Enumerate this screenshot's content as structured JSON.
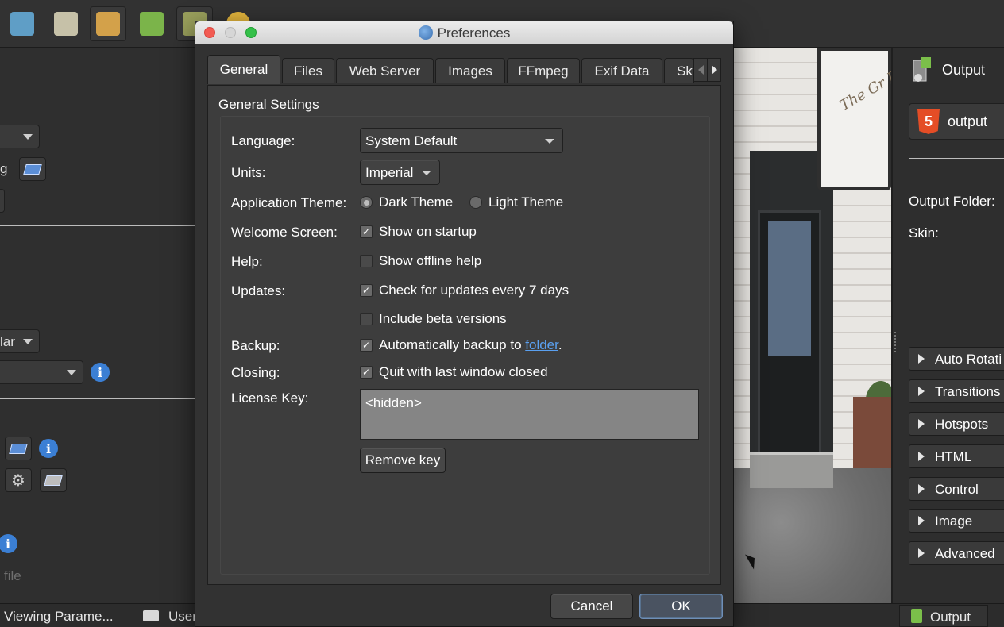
{
  "toolbar": {
    "buttons": [
      {
        "name": "screen-view-icon",
        "color": "#5f9ec6"
      },
      {
        "name": "contact-card-icon",
        "color": "#c6c1a8"
      },
      {
        "name": "flow-diagram-icon",
        "color": "#d3a14a"
      },
      {
        "name": "map-pin-icon",
        "color": "#7bb44a"
      },
      {
        "name": "tool-icon",
        "color": "#9aa05c"
      },
      {
        "name": "google-icon",
        "color": "#e2b43c"
      }
    ]
  },
  "left_panel": {
    "row_text_1": "g",
    "combo_1_text": "lar",
    "status_text": "file"
  },
  "dialog": {
    "title": "Preferences",
    "tabs": [
      {
        "label": "General"
      },
      {
        "label": "Files"
      },
      {
        "label": "Web Server"
      },
      {
        "label": "Images"
      },
      {
        "label": "FFmpeg"
      },
      {
        "label": "Exif Data"
      },
      {
        "label": "Sk"
      }
    ],
    "group_title": "General Settings",
    "language": {
      "label": "Language:",
      "value": "System Default"
    },
    "units": {
      "label": "Units:",
      "value": "Imperial"
    },
    "theme": {
      "label": "Application Theme:",
      "dark": "Dark Theme",
      "light": "Light Theme",
      "selected": "dark"
    },
    "welcome": {
      "label": "Welcome Screen:",
      "option": "Show on startup",
      "checked": true
    },
    "help": {
      "label": "Help:",
      "option": "Show offline help",
      "checked": false
    },
    "updates": {
      "label": "Updates:",
      "option": "Check for updates every 7 days",
      "checked": true,
      "beta": "Include beta versions",
      "beta_checked": false
    },
    "backup": {
      "label": "Backup:",
      "prefix": "Automatically backup to ",
      "link": "folder",
      "suffix": ".",
      "checked": true
    },
    "closing": {
      "label": "Closing:",
      "option": "Quit with last window closed",
      "checked": true
    },
    "license": {
      "label": "License Key:",
      "value": "<hidden>",
      "remove_button": "Remove key"
    },
    "cancel_button": "Cancel",
    "ok_button": "OK"
  },
  "right_panel": {
    "title": "Output",
    "combo_value": "output",
    "output_folder_label": "Output Folder:",
    "skin_label": "Skin:",
    "sections": [
      "Auto Rotati",
      "Transitions",
      "Hotspots",
      "HTML",
      "Control",
      "Image",
      "Advanced"
    ]
  },
  "statusbar": {
    "viewing": "Viewing Parame...",
    "user": "User",
    "output": "Output"
  },
  "preview": {
    "sign_text": "The Gr Room"
  }
}
